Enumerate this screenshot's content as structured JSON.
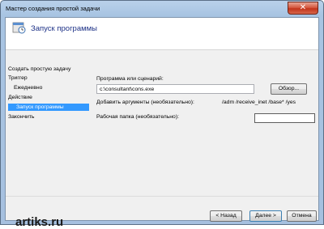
{
  "window": {
    "title": "Мастер создания простой задачи",
    "close_label": "✕"
  },
  "header": {
    "title": "Запуск программы",
    "icon": "task-clock-icon"
  },
  "nav": {
    "items": [
      {
        "label": "Создать простую задачу",
        "selected": false
      },
      {
        "label": "Триггер",
        "selected": false
      },
      {
        "label": "Ежедневно",
        "selected": false
      },
      {
        "label": "Действие",
        "selected": false
      },
      {
        "label": "Запуск программы",
        "selected": true
      },
      {
        "label": "Закончить",
        "selected": false
      }
    ]
  },
  "form": {
    "program_label": "Программа или сценарий:",
    "program_value": "c:\\consultant\\cons.exe",
    "browse_label": "Обзор...",
    "args_label": "Добавить аргументы (необязательно):",
    "args_value": "/adm  /receive_inet /base* /yes",
    "workdir_label": "Рабочая папка (необязательно):",
    "workdir_value": ""
  },
  "footer": {
    "watermark": "artiks.ru",
    "back_label": "< Назад",
    "next_label": "Далее >",
    "cancel_label": "Отмена"
  },
  "colors": {
    "selection": "#3399ff",
    "header_title": "#1e3287"
  }
}
